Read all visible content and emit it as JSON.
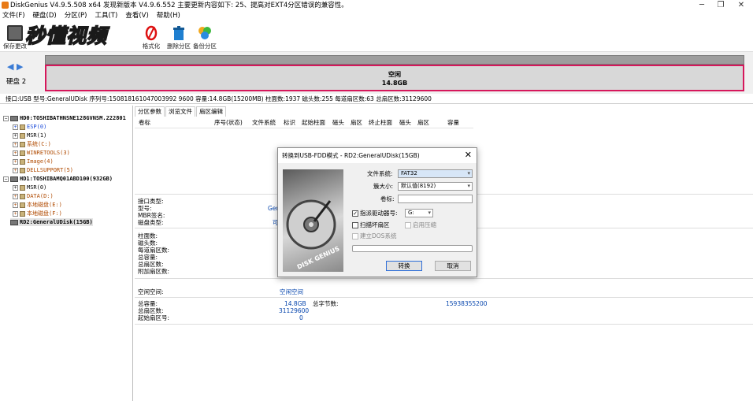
{
  "window": {
    "title": "DiskGenius V4.9.5.508 x64  发现新版本 V4.9.6.552 主要更新内容如下: 25、提高对EXT4分区错误的兼容性。",
    "controls": [
      "─",
      "❐",
      "✕"
    ]
  },
  "menu": [
    "文件(F)",
    "硬盘(D)",
    "分区(P)",
    "工具(T)",
    "查看(V)",
    "帮助(H)"
  ],
  "toolbar": {
    "save_label": "保存更改",
    "format_label": "格式化",
    "delete_label": "删除分区",
    "backup_label": "备份分区",
    "watermark": "秒懂视频"
  },
  "diskmap": {
    "disk_label": "硬盘 2",
    "free_title": "空闲",
    "free_size": "14.8GB"
  },
  "infobar": "接口:USB  型号:GeneralUDisk  序列号:150818161047003992 9600  容量:14.8GB(15200MB)  柱面数:1937  磁头数:255  每道扇区数:63  总扇区数:31129600",
  "tree": {
    "hd0": "HD0:TOSHIBATHNSNE128GVNSM.222801",
    "hd0_parts": [
      "ESP(0)",
      "MSR(1)",
      "系统(C:)",
      "WINRETOOLS(3)",
      "Image(4)",
      "DELLSUPPORT(5)"
    ],
    "hd1": "HD1:TOSHIBAMQ01ABD100(932GB)",
    "hd1_parts": [
      "MSR(0)",
      "DATA(D:)",
      "本地磁盘(E:)",
      "本地磁盘(F:)"
    ],
    "rd2": "RD2:GeneralUDisk(15GB)"
  },
  "tabs": [
    "分区参数",
    "浏览文件",
    "扇区编辑"
  ],
  "columns": [
    "卷标",
    "序号(状态)",
    "文件系统",
    "标识",
    "起始柱面",
    "磁头",
    "扇区",
    "终止柱面",
    "磁头",
    "扇区",
    "容量"
  ],
  "details": {
    "iface_label": "接口类型:",
    "iface_value": "",
    "model_label": "型号:",
    "model_value": "Gen",
    "mbr_label": "MBR签名:",
    "disktype_label": "磁盘类型:",
    "disktype_value": "可",
    "cyl_label": "柱面数:",
    "heads_label": "磁头数:",
    "spt_label": "每道扇区数:",
    "total_cap_label1": "总容量:",
    "total_sec_label1": "总扇区数:",
    "extra_sec_label": "附加扇区数:",
    "free_space_label": "空闲空间:",
    "free_space_value": "空闲空间",
    "cap_label": "总容量:",
    "cap_value": "14.8GB",
    "bytes_label": "总字节数:",
    "bytes_value": "15938355200",
    "sectors_label": "总扇区数:",
    "sectors_value": "31129600",
    "start_label": "起始扇区号:",
    "start_value": "0"
  },
  "dialog": {
    "title": "转换到USB-FDD模式 - RD2:GeneralUDisk(15GB)",
    "fs_label": "文件系统:",
    "fs_value": "FAT32",
    "cluster_label": "簇大小:",
    "cluster_value": "默认值(8192)",
    "volume_label": "卷标:",
    "volume_value": "",
    "drive_label": "指派驱动器号:",
    "drive_value": "G:",
    "drive_checked": true,
    "scan_label": "扫描坏扇区",
    "scan_checked": false,
    "compress_label": "启用压缩",
    "dos_label": "建立DOS系统",
    "convert_label": "转换",
    "cancel_label": "取消",
    "image_text": "DISK GENIUS"
  },
  "colors": {
    "accent": "#d6175b",
    "link": "#0645ad"
  }
}
